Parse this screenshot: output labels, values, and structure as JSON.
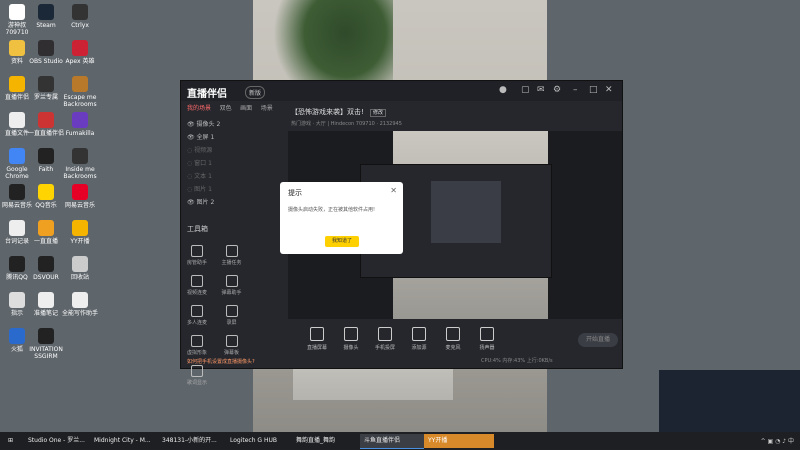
{
  "desktop": {
    "icons": [
      {
        "label": "游神叔",
        "sub": "709710",
        "color": "#ffffff"
      },
      {
        "label": "Steam",
        "color": "#1b2838"
      },
      {
        "label": "Ctrlyx",
        "color": "#333"
      },
      {
        "label": "资料",
        "color": "#f0c040"
      },
      {
        "label": "OBS Studio",
        "color": "#302e31"
      },
      {
        "label": "Apex 英雄",
        "color": "#c23"
      },
      {
        "label": "直播伴侣",
        "color": "#f5b400"
      },
      {
        "label": "罗兰专属",
        "color": "#333"
      },
      {
        "label": "Escape me Backrooms",
        "color": "#b87a2a"
      },
      {
        "label": "直播文件",
        "color": "#eee"
      },
      {
        "label": "一直直播伴侣",
        "color": "#c33"
      },
      {
        "label": "Fumakilla",
        "color": "#6a3cc0"
      },
      {
        "label": "Google Chrome",
        "color": "#4285f4"
      },
      {
        "label": "Faith",
        "color": "#222"
      },
      {
        "label": "Inside me Backrooms",
        "color": "#333"
      },
      {
        "label": "网易云音乐",
        "color": "#222"
      },
      {
        "label": "QQ音乐",
        "color": "#ffd400"
      },
      {
        "label": "网易云音乐",
        "color": "#e60026"
      },
      {
        "label": "台词记录",
        "color": "#eee"
      },
      {
        "label": "一直直播",
        "color": "#f0a020"
      },
      {
        "label": "YY开播",
        "color": "#f5b400"
      },
      {
        "label": "腾讯QQ",
        "color": "#222"
      },
      {
        "label": "DSVOUR",
        "color": "#222"
      },
      {
        "label": "回收站",
        "color": "#ccc"
      },
      {
        "label": "指示",
        "color": "#ddd"
      },
      {
        "label": "准播笔记",
        "color": "#eee"
      },
      {
        "label": "全能写作助手",
        "color": "#eee"
      },
      {
        "label": "火狐",
        "color": "#2a6acc"
      },
      {
        "label": "INVITATION SSGIRM",
        "color": "#222"
      }
    ]
  },
  "app": {
    "logo": "直播伴侣",
    "version": "新版",
    "left_tabs": [
      "我的场景",
      "双色",
      "画面",
      "场景"
    ],
    "sources": [
      {
        "label": "摄像头 2",
        "dim": false
      },
      {
        "label": "全屏 1",
        "dim": false
      },
      {
        "label": "视频源",
        "dim": true
      },
      {
        "label": "窗口 1",
        "dim": true
      },
      {
        "label": "文本 1",
        "dim": true
      },
      {
        "label": "图片 1",
        "dim": true
      },
      {
        "label": "图片 2",
        "dim": false
      }
    ],
    "tools_heading": "工具箱",
    "tools": [
      {
        "label": "房管助手"
      },
      {
        "label": "主播任务"
      },
      {
        "label": "视频连麦"
      },
      {
        "label": "弹幕助手"
      },
      {
        "label": "多人连麦"
      },
      {
        "label": "录屏"
      },
      {
        "label": "虚拟形象"
      },
      {
        "label": "弹幕板"
      },
      {
        "label": "歌词显示"
      }
    ],
    "hint": "如何把手机设置成直播摄像头?",
    "top_title": "【恐怖游戏来袭】双击!",
    "top_tag": "修改",
    "top_sub": "热门游戏 · 大厅  |  Hindecon  709710  ·  2132945",
    "controls": [
      {
        "label": "直播屏幕"
      },
      {
        "label": "摄像头"
      },
      {
        "label": "手机投屏"
      },
      {
        "label": "添加源"
      },
      {
        "label": "麦克风"
      },
      {
        "label": "扬声器"
      }
    ],
    "go_live": "开始直播",
    "stats": "CPU:4%  内存:43%  上行:0KB/s"
  },
  "dialog": {
    "title": "提示",
    "message": "摄像头启动失败，正在被其他软件占用!",
    "button": "我知道了"
  },
  "taskbar": {
    "items": [
      {
        "label": "Studio One - 罗兰..."
      },
      {
        "label": "Midnight City - M..."
      },
      {
        "label": "348131-小新的开..."
      },
      {
        "label": "Logitech G HUB"
      },
      {
        "label": "舞韵直播_舞韵"
      },
      {
        "label": "斗鱼直播伴侣"
      },
      {
        "label": "YY开播"
      }
    ]
  }
}
